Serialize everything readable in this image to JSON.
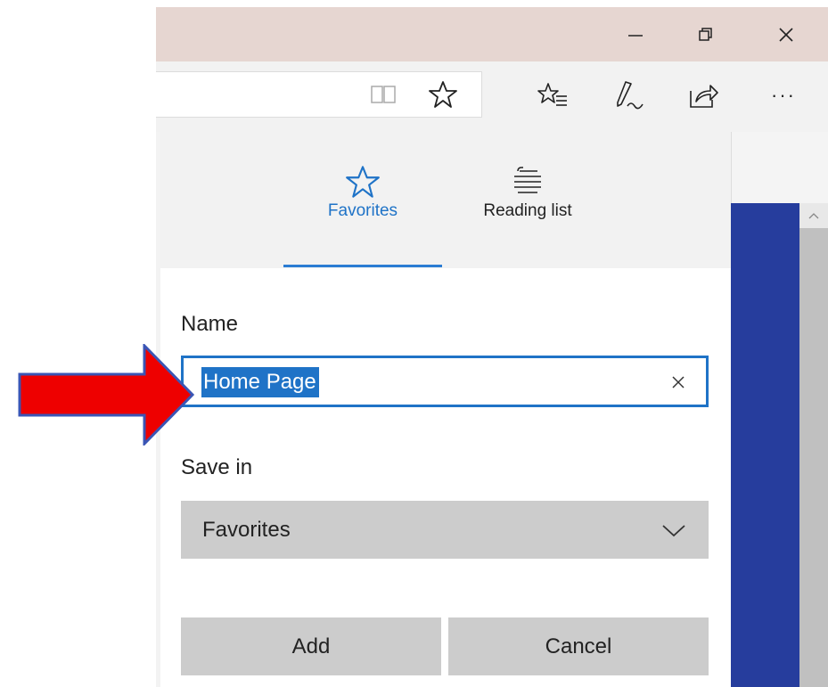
{
  "window": {
    "controls": {
      "minimize_icon": "minimize-icon",
      "restore_icon": "restore-icon",
      "close_icon": "close-icon"
    }
  },
  "toolbar": {
    "icons": [
      "reading-view-icon",
      "favorite-star-icon",
      "hub-icon",
      "web-note-icon",
      "share-icon",
      "more-icon"
    ],
    "more_label": "···"
  },
  "hub": {
    "tabs": [
      {
        "label": "Favorites",
        "icon": "star-outline-icon",
        "active": true
      },
      {
        "label": "Reading list",
        "icon": "reading-list-icon",
        "active": false
      }
    ],
    "form": {
      "name_label": "Name",
      "name_value": "Home Page",
      "save_in_label": "Save in",
      "save_in_value": "Favorites",
      "add_label": "Add",
      "cancel_label": "Cancel"
    }
  },
  "colors": {
    "accent": "#1f73c7",
    "titlebar": "#e6d6d1",
    "content_blue": "#263d9d",
    "annotation_arrow": "#ee0000"
  }
}
